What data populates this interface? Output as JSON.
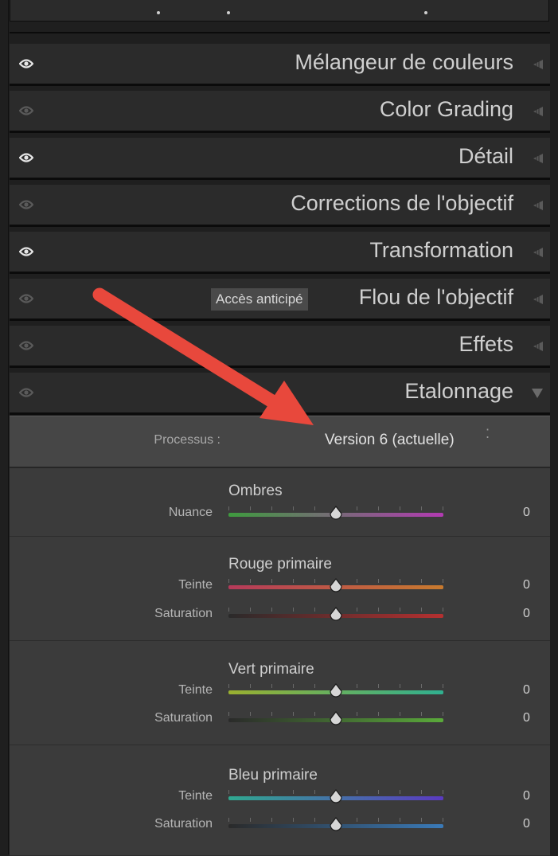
{
  "panels": [
    {
      "key": "melangeur",
      "title": "Mélangeur de couleurs",
      "eye": "bright",
      "icon": "eye-icon"
    },
    {
      "key": "colorgrading",
      "title": "Color Grading",
      "eye": "dim",
      "icon": "eye-icon"
    },
    {
      "key": "detail",
      "title": "Détail",
      "eye": "bright",
      "icon": "eye-icon"
    },
    {
      "key": "corrections",
      "title": "Corrections de l'objectif",
      "eye": "dim",
      "icon": "eye-icon"
    },
    {
      "key": "transformation",
      "title": "Transformation",
      "eye": "bright",
      "icon": "eye-icon"
    },
    {
      "key": "flou",
      "title": "Flou de l'objectif",
      "eye": "dim",
      "icon": "eye-icon",
      "badge": "Accès anticipé"
    },
    {
      "key": "effets",
      "title": "Effets",
      "eye": "dim",
      "icon": "eye-icon"
    },
    {
      "key": "etalonnage",
      "title": "Etalonnage",
      "eye": "dim",
      "icon": "eye-icon",
      "expanded": true
    }
  ],
  "etalonnage": {
    "process_label": "Processus :",
    "process_value": "Version 6 (actuelle)",
    "sections": [
      {
        "title": "Ombres",
        "rows": [
          {
            "label": "Nuance",
            "value": "0",
            "gradient": [
              "#3e9a3e",
              "#b23ab2"
            ]
          }
        ]
      },
      {
        "title": "Rouge primaire",
        "rows": [
          {
            "label": "Teinte",
            "value": "0",
            "gradient": [
              "#b53a5a",
              "#c87a2e"
            ]
          },
          {
            "label": "Saturation",
            "value": "0",
            "gradient": [
              "#2a2a2a",
              "#b53030"
            ]
          }
        ]
      },
      {
        "title": "Vert primaire",
        "rows": [
          {
            "label": "Teinte",
            "value": "0",
            "gradient": [
              "#9ab030",
              "#30b090"
            ]
          },
          {
            "label": "Saturation",
            "value": "0",
            "gradient": [
              "#2a2a2a",
              "#5aaa3a"
            ]
          }
        ]
      },
      {
        "title": "Bleu primaire",
        "rows": [
          {
            "label": "Teinte",
            "value": "0",
            "gradient": [
              "#30a890",
              "#5a3ac0"
            ]
          },
          {
            "label": "Saturation",
            "value": "0",
            "gradient": [
              "#2a2a2a",
              "#3a7ab8"
            ]
          }
        ]
      }
    ]
  },
  "annotation": {
    "icon": "red-arrow-icon",
    "color": "#e8483c"
  }
}
